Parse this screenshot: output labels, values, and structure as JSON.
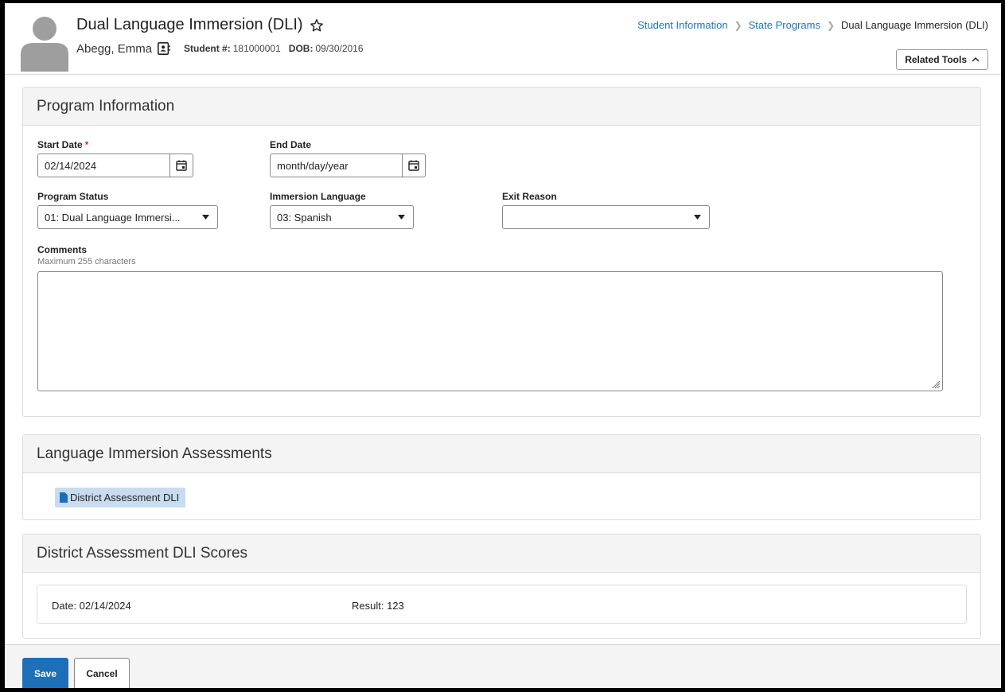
{
  "header": {
    "title": "Dual Language Immersion (DLI)",
    "student_name": "Abegg, Emma",
    "student_number_label": "Student #:",
    "student_number": "181000001",
    "dob_label": "DOB:",
    "dob": "09/30/2016",
    "related_tools_label": "Related Tools"
  },
  "breadcrumb": {
    "items": [
      "Student Information",
      "State Programs",
      "Dual Language Immersion (DLI)"
    ]
  },
  "program_information": {
    "title": "Program Information",
    "start_date_label": "Start Date",
    "required_mark": "*",
    "start_date_value": "02/14/2024",
    "end_date_label": "End Date",
    "end_date_placeholder": "month/day/year",
    "program_status_label": "Program Status",
    "program_status_value": "01: Dual Language Immersi...",
    "immersion_language_label": "Immersion Language",
    "immersion_language_value": "03: Spanish",
    "exit_reason_label": "Exit Reason",
    "exit_reason_value": "",
    "comments_label": "Comments",
    "comments_hint": "Maximum 255 characters",
    "comments_value": ""
  },
  "assessments": {
    "title": "Language Immersion Assessments",
    "items": [
      "District Assessment DLI"
    ]
  },
  "scores": {
    "title": "District Assessment DLI Scores",
    "date_text": "Date: 02/14/2024",
    "result_text": "Result: 123"
  },
  "footer": {
    "save_label": "Save",
    "cancel_label": "Cancel"
  },
  "colors": {
    "link": "#1e73be",
    "primary_button": "#1d6fb8",
    "chip_background": "#c7dcef",
    "required": "#c0392b"
  },
  "icons": [
    "avatar",
    "star-icon",
    "contact-card-icon",
    "chevron-up-icon",
    "calendar-icon",
    "caret-down-icon",
    "document-icon",
    "resize-grip-icon"
  ]
}
